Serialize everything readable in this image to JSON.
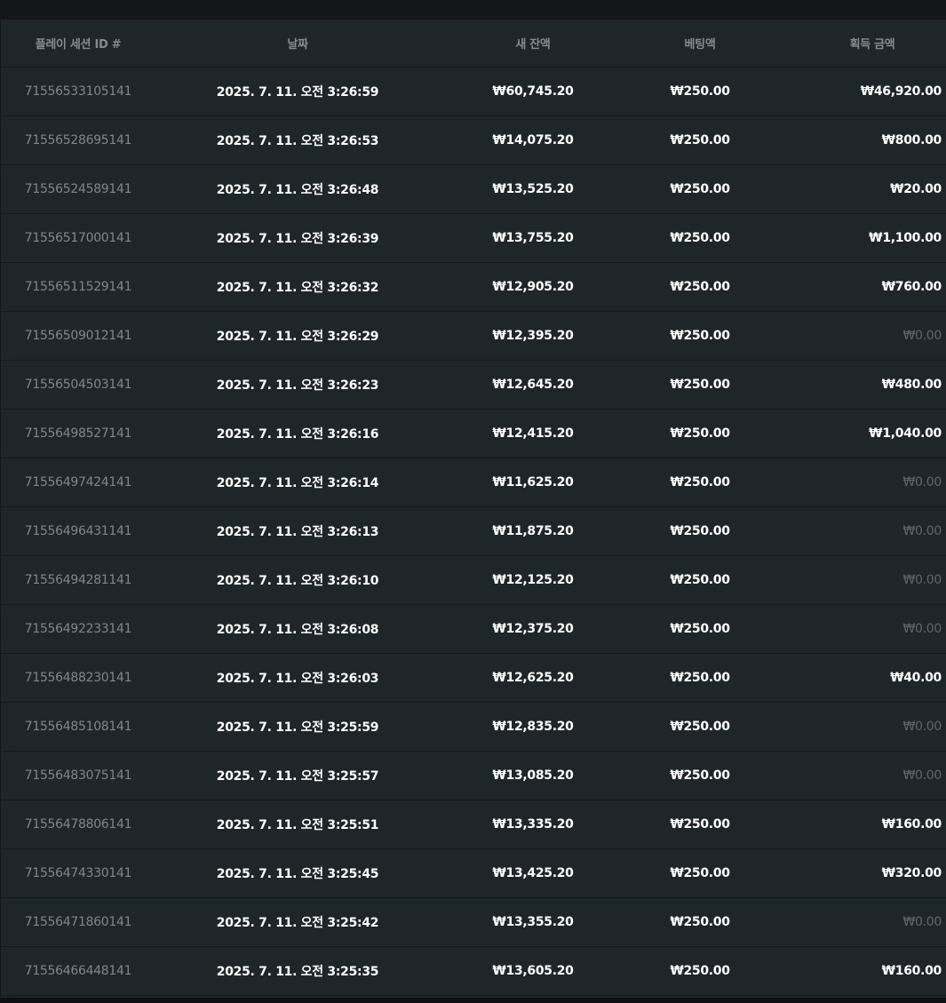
{
  "table": {
    "headers": {
      "session_id": "플레이 세션 ID #",
      "date": "날짜",
      "new_balance": "새 잔액",
      "bet_amount": "베팅액",
      "win_amount": "획득 금액"
    },
    "rows": [
      {
        "id": "71556533105141",
        "date": "2025. 7. 11. 오전 3:26:59",
        "balance": "₩60,745.20",
        "bet": "₩250.00",
        "win": "₩46,920.00"
      },
      {
        "id": "71556528695141",
        "date": "2025. 7. 11. 오전 3:26:53",
        "balance": "₩14,075.20",
        "bet": "₩250.00",
        "win": "₩800.00"
      },
      {
        "id": "71556524589141",
        "date": "2025. 7. 11. 오전 3:26:48",
        "balance": "₩13,525.20",
        "bet": "₩250.00",
        "win": "₩20.00"
      },
      {
        "id": "71556517000141",
        "date": "2025. 7. 11. 오전 3:26:39",
        "balance": "₩13,755.20",
        "bet": "₩250.00",
        "win": "₩1,100.00"
      },
      {
        "id": "71556511529141",
        "date": "2025. 7. 11. 오전 3:26:32",
        "balance": "₩12,905.20",
        "bet": "₩250.00",
        "win": "₩760.00"
      },
      {
        "id": "71556509012141",
        "date": "2025. 7. 11. 오전 3:26:29",
        "balance": "₩12,395.20",
        "bet": "₩250.00",
        "win": "₩0.00"
      },
      {
        "id": "71556504503141",
        "date": "2025. 7. 11. 오전 3:26:23",
        "balance": "₩12,645.20",
        "bet": "₩250.00",
        "win": "₩480.00"
      },
      {
        "id": "71556498527141",
        "date": "2025. 7. 11. 오전 3:26:16",
        "balance": "₩12,415.20",
        "bet": "₩250.00",
        "win": "₩1,040.00"
      },
      {
        "id": "71556497424141",
        "date": "2025. 7. 11. 오전 3:26:14",
        "balance": "₩11,625.20",
        "bet": "₩250.00",
        "win": "₩0.00"
      },
      {
        "id": "71556496431141",
        "date": "2025. 7. 11. 오전 3:26:13",
        "balance": "₩11,875.20",
        "bet": "₩250.00",
        "win": "₩0.00"
      },
      {
        "id": "71556494281141",
        "date": "2025. 7. 11. 오전 3:26:10",
        "balance": "₩12,125.20",
        "bet": "₩250.00",
        "win": "₩0.00"
      },
      {
        "id": "71556492233141",
        "date": "2025. 7. 11. 오전 3:26:08",
        "balance": "₩12,375.20",
        "bet": "₩250.00",
        "win": "₩0.00"
      },
      {
        "id": "71556488230141",
        "date": "2025. 7. 11. 오전 3:26:03",
        "balance": "₩12,625.20",
        "bet": "₩250.00",
        "win": "₩40.00"
      },
      {
        "id": "71556485108141",
        "date": "2025. 7. 11. 오전 3:25:59",
        "balance": "₩12,835.20",
        "bet": "₩250.00",
        "win": "₩0.00"
      },
      {
        "id": "71556483075141",
        "date": "2025. 7. 11. 오전 3:25:57",
        "balance": "₩13,085.20",
        "bet": "₩250.00",
        "win": "₩0.00"
      },
      {
        "id": "71556478806141",
        "date": "2025. 7. 11. 오전 3:25:51",
        "balance": "₩13,335.20",
        "bet": "₩250.00",
        "win": "₩160.00"
      },
      {
        "id": "71556474330141",
        "date": "2025. 7. 11. 오전 3:25:45",
        "balance": "₩13,425.20",
        "bet": "₩250.00",
        "win": "₩320.00"
      },
      {
        "id": "71556471860141",
        "date": "2025. 7. 11. 오전 3:25:42",
        "balance": "₩13,355.20",
        "bet": "₩250.00",
        "win": "₩0.00"
      },
      {
        "id": "71556466448141",
        "date": "2025. 7. 11. 오전 3:25:35",
        "balance": "₩13,605.20",
        "bet": "₩250.00",
        "win": "₩160.00"
      }
    ]
  },
  "colors": {
    "page_bg": "#15191c",
    "table_bg": "#1f2629",
    "row_divider": "#141819",
    "id_text": "#7f878b",
    "value_text": "#ffffff",
    "zero_win_text": "#5f6669"
  }
}
